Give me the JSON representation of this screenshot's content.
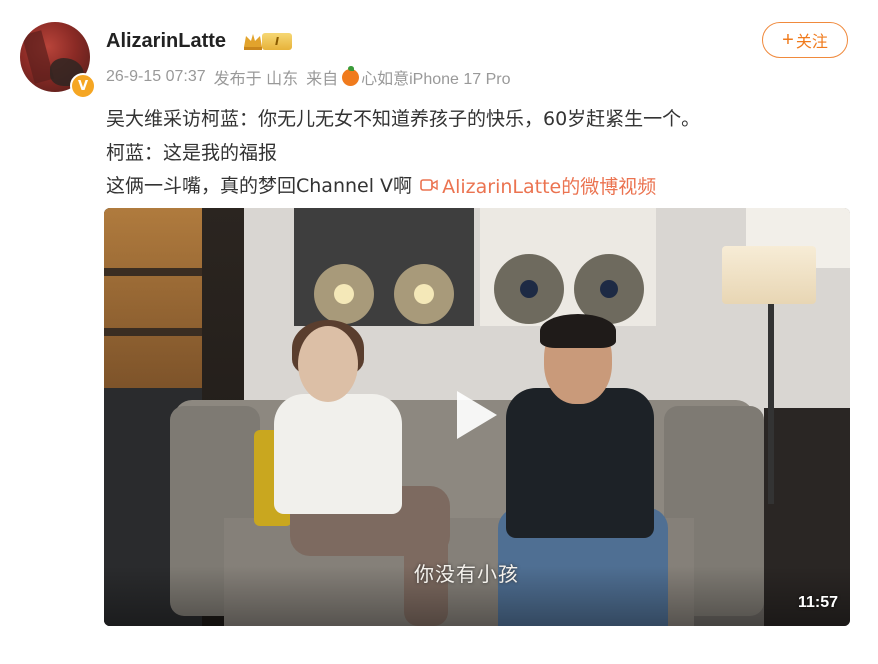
{
  "post": {
    "author": {
      "name": "AlizarinLatte",
      "verified_badge": "V",
      "level_badge": "I",
      "avatar_icon": "avatar"
    },
    "timestamp": "26-9-15 07:37",
    "posted_in": "发布于 山东",
    "source_prefix": "来自",
    "device": "心如意iPhone 17 Pro",
    "follow_label": "关注",
    "follow_plus": "+",
    "lines": [
      "吴大维采访柯蓝：你无儿无女不知道养孩子的快乐，60岁赶紧生一个。",
      "柯蓝：这是我的福报",
      "这俩一斗嘴，真的梦回Channel V啊"
    ],
    "video_link_text": "AlizarinLatte的微博视频",
    "video": {
      "subtitle": "你没有小孩",
      "duration": "11:57"
    }
  },
  "colors": {
    "accent_orange": "#f07b1d",
    "link_color": "#eb7350",
    "meta_gray": "#999999",
    "text_dark": "#333333"
  }
}
